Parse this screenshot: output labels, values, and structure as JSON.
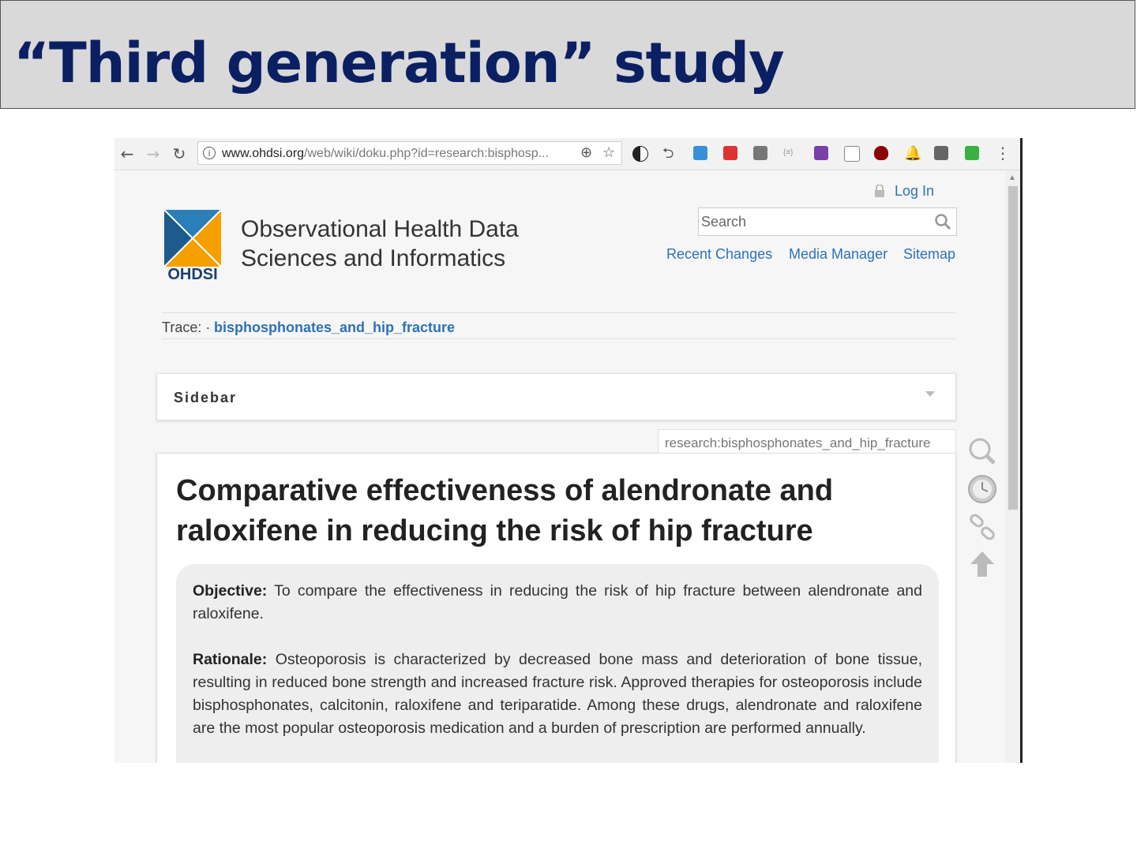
{
  "slide": {
    "title": "“Third generation” study"
  },
  "browser": {
    "url_domain": "www.ohdsi.org",
    "url_path": "/web/wiki/doku.php?id=research:bisphosp..."
  },
  "site": {
    "login_label": "Log In",
    "title_line1": "Observational Health Data",
    "title_line2": "Sciences and Informatics",
    "logo_text": "OHDSI",
    "search_placeholder": "Search",
    "links": [
      "Recent Changes",
      "Media Manager",
      "Sitemap"
    ],
    "trace_label": "Trace: ·",
    "trace_link": "bisphosphonates_and_hip_fracture",
    "sidebar_label": "Sidebar",
    "page_id": "research:bisphosphonates_and_hip_fracture"
  },
  "article": {
    "title": "Comparative effectiveness of alendronate and raloxifene in reducing the risk of hip fracture",
    "objective_label": "Objective:",
    "objective_text": "To compare the effectiveness in reducing the risk of hip fracture between alendronate and raloxifene.",
    "rationale_label": "Rationale:",
    "rationale_text": "Osteoporosis is characterized by decreased bone mass and deterioration of bone tissue, resulting in reduced bone strength and increased fracture risk. Approved therapies for osteoporosis include bisphosphonates, calcitonin, raloxifene and teriparatide. Among these drugs, alendronate and raloxifene are the most popular osteoporosis medication and a burden of prescription are performed annually."
  },
  "colors": {
    "title": "#0b1f63",
    "link": "#2b73b7",
    "header_bg": "#d9d9d9"
  }
}
